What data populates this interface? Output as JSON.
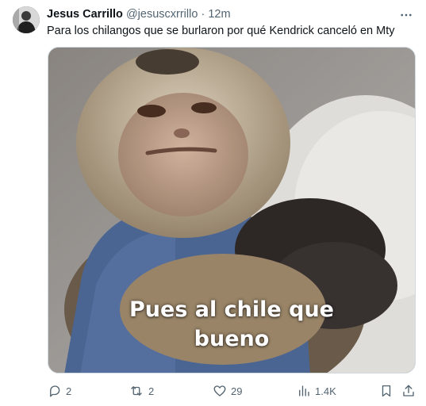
{
  "tweet": {
    "display_name": "Jesus Carrillo",
    "handle": "@jesuscxrrillo",
    "separator": "·",
    "time": "12m",
    "text": "Para los chilangos que se burlaron por qué Kendrick canceló en Mty"
  },
  "media": {
    "caption_line1": "Pues al chile que",
    "caption_line2": "bueno"
  },
  "actions": {
    "replies": "2",
    "reposts": "2",
    "likes": "29",
    "views": "1.4K"
  },
  "colors": {
    "text_primary": "#0f1419",
    "text_secondary": "#536471",
    "border": "#cfd9de"
  },
  "icons": [
    "more-icon",
    "reply-icon",
    "repost-icon",
    "like-icon",
    "views-icon",
    "bookmark-icon",
    "share-icon"
  ]
}
